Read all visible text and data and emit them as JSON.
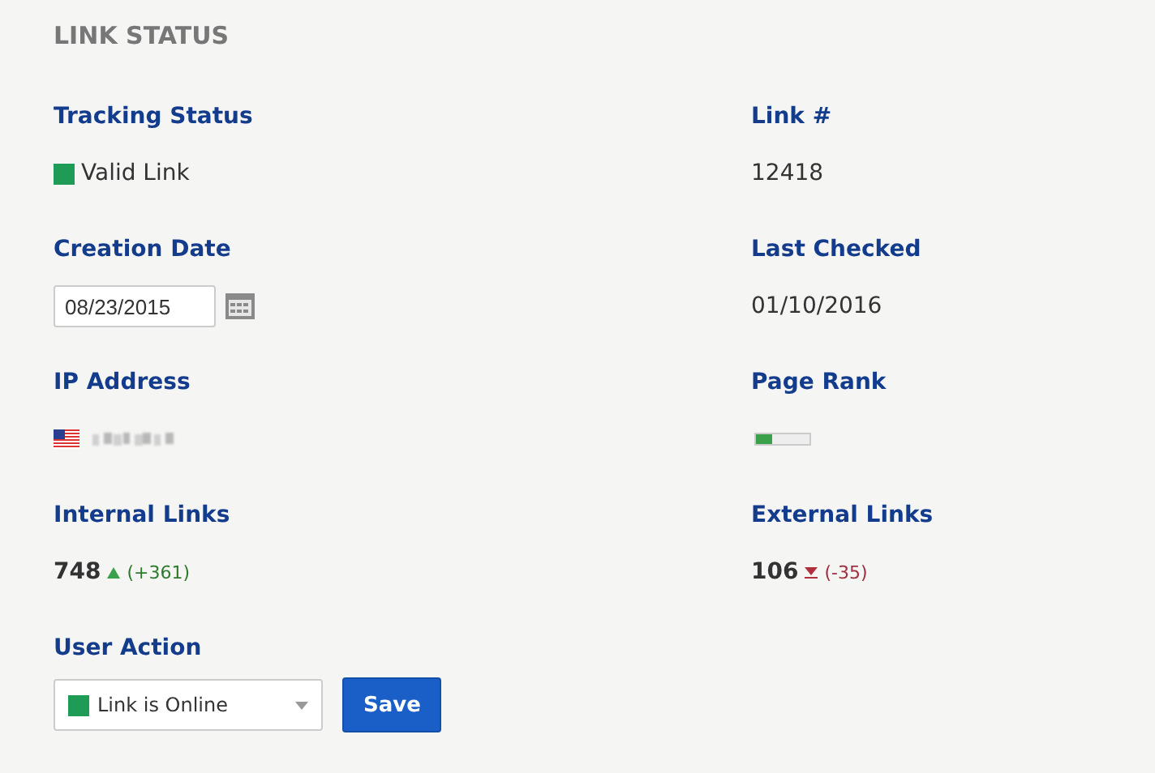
{
  "title": "LINK STATUS",
  "fields": [
    {
      "label": "Tracking Status",
      "kind": "status",
      "color": "#1e9b55",
      "text": "Valid Link"
    },
    {
      "label": "Link #",
      "kind": "text",
      "text": "12418"
    },
    {
      "label": "Creation Date",
      "kind": "date",
      "value": "08/23/2015"
    },
    {
      "label": "Last Checked",
      "kind": "text",
      "text": "01/10/2016"
    },
    {
      "label": "IP Address",
      "kind": "ip"
    },
    {
      "label": "Page Rank",
      "kind": "rank",
      "level": 0.3
    },
    {
      "label": "Internal Links",
      "kind": "count",
      "text": "748",
      "change": "(+361)",
      "rising": true
    },
    {
      "label": "External Links",
      "kind": "count",
      "text": "106",
      "change": "(-35)",
      "rising": false
    },
    {
      "label": "User Action",
      "kind": "action",
      "color": "#1e9b55",
      "text": "Link is Online"
    }
  ],
  "button": "Save"
}
